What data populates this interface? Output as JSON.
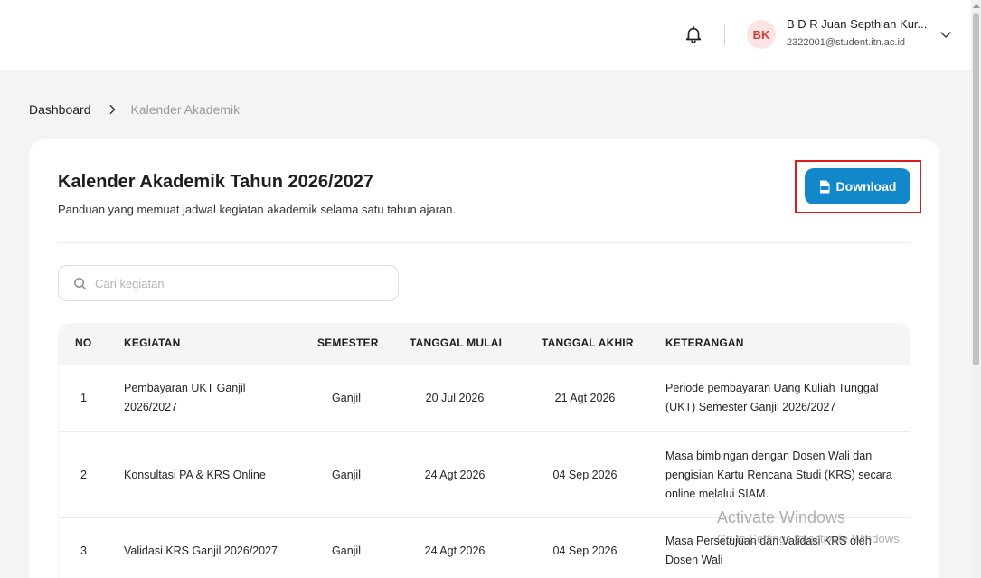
{
  "header": {
    "user_initials": "BK",
    "user_name": "B D R Juan Septhian Kur...",
    "user_email": "2322001@student.itn.ac.id"
  },
  "breadcrumb": {
    "home": "Dashboard",
    "current": "Kalender Akademik"
  },
  "page": {
    "title": "Kalender Akademik Tahun 2026/2027",
    "subtitle": "Panduan yang memuat jadwal kegiatan akademik selama satu tahun ajaran.",
    "download_label": "Download"
  },
  "search": {
    "placeholder": "Cari kegiatan",
    "value": ""
  },
  "table": {
    "columns": [
      "NO",
      "KEGIATAN",
      "SEMESTER",
      "TANGGAL MULAI",
      "TANGGAL AKHIR",
      "KETERANGAN"
    ],
    "rows": [
      {
        "no": "1",
        "kegiatan": "Pembayaran UKT Ganjil 2026/2027",
        "semester": "Ganjil",
        "mulai": "20 Jul 2026",
        "akhir": "21 Agt 2026",
        "keterangan": "Periode pembayaran Uang Kuliah Tunggal (UKT) Semester Ganjil 2026/2027"
      },
      {
        "no": "2",
        "kegiatan": "Konsultasi PA & KRS Online",
        "semester": "Ganjil",
        "mulai": "24 Agt 2026",
        "akhir": "04 Sep 2026",
        "keterangan": "Masa bimbingan dengan Dosen Wali dan pengisian Kartu Rencana Studi (KRS) secara online melalui SIAM."
      },
      {
        "no": "3",
        "kegiatan": "Validasi KRS Ganjil 2026/2027",
        "semester": "Ganjil",
        "mulai": "24 Agt 2026",
        "akhir": "04 Sep 2026",
        "keterangan": "Masa Persetujuan dan Validasi KRS oleh Dosen Wali"
      }
    ]
  },
  "watermark": {
    "line1": "Activate Windows",
    "line2": "Go to Settings to activate Windows."
  },
  "colors": {
    "accent": "#1287c9",
    "highlight": "#e01b1b",
    "avatar_bg": "#fbe4e4",
    "avatar_text": "#d23a3a"
  }
}
